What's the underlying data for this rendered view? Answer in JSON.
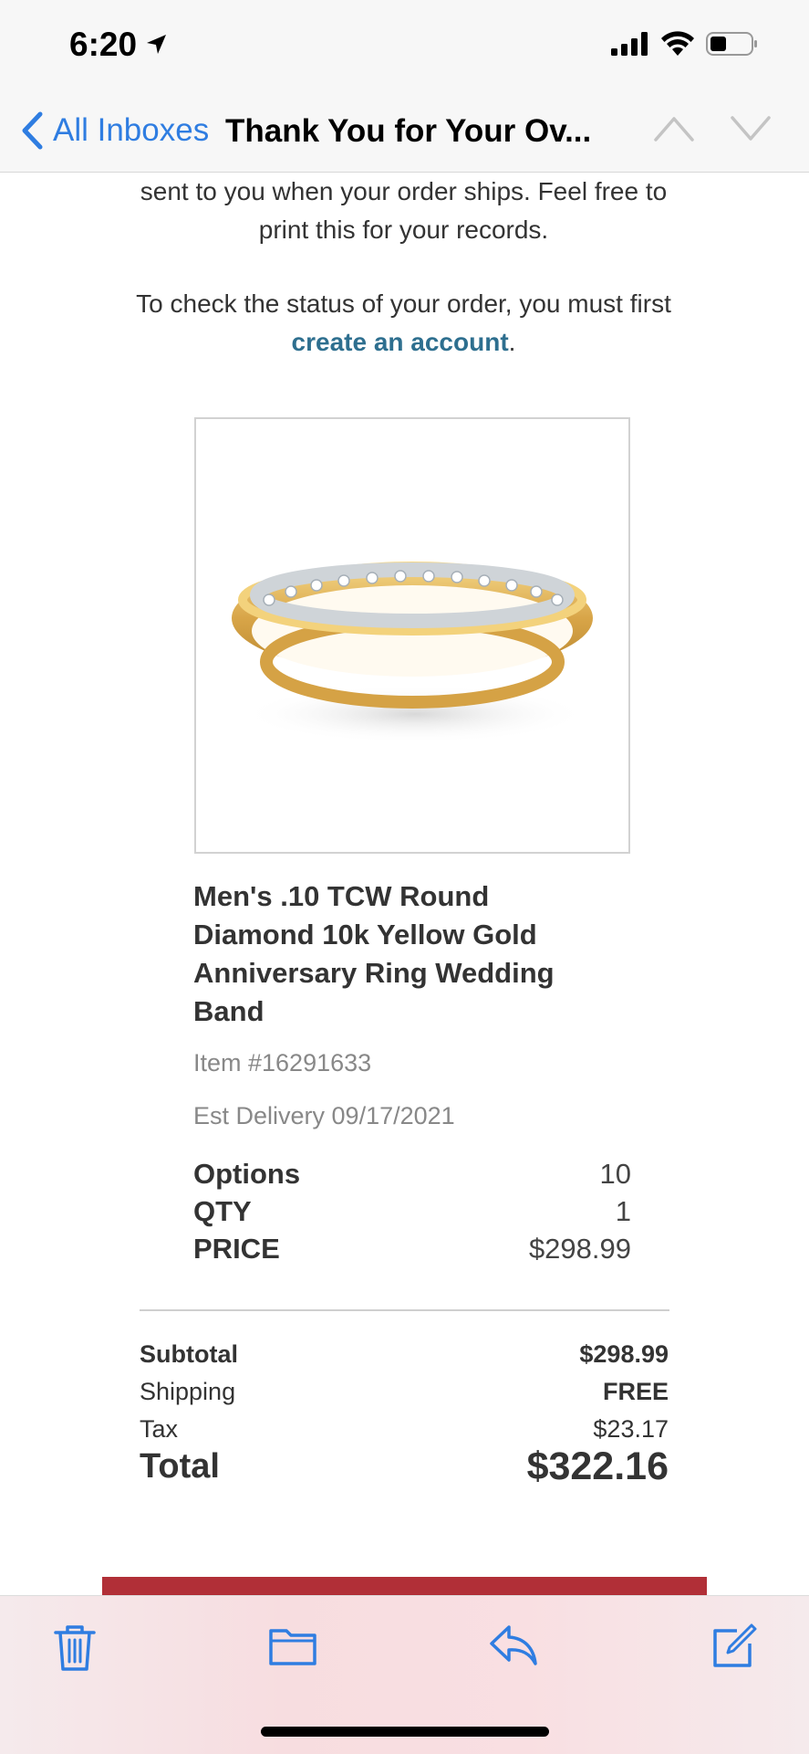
{
  "status_bar": {
    "time": "6:20"
  },
  "nav": {
    "back_label": "All Inboxes",
    "title": "Thank You for Your Ov..."
  },
  "email": {
    "intro_line1": "sent to you when your order ships. Feel free to",
    "intro_line2": "print this for your records.",
    "status_line": "To check the status of your order, you must first",
    "account_link": "create an account",
    "account_suffix": ".",
    "product": {
      "name_lines": [
        "Men's .10 TCW Round",
        "Diamond 10k Yellow Gold",
        "Anniversary Ring Wedding",
        "Band"
      ],
      "item_number": "Item #16291633",
      "est_delivery": "Est Delivery 09/17/2021",
      "options_label": "Options",
      "options_value": "10",
      "qty_label": "QTY",
      "qty_value": "1",
      "price_label": "PRICE",
      "price_value": "$298.99"
    },
    "summary": {
      "subtotal_label": "Subtotal",
      "subtotal_value": "$298.99",
      "shipping_label": "Shipping",
      "shipping_value": "FREE",
      "tax_label": "Tax",
      "tax_value": "$23.17",
      "total_label": "Total",
      "total_value": "$322.16"
    },
    "accent_color": "#b12f37",
    "link_color": "#2e6f8f"
  },
  "toolbar": {
    "icons": [
      "trash-icon",
      "folder-icon",
      "reply-icon",
      "compose-icon"
    ],
    "tint_color": "#2f7de1"
  }
}
